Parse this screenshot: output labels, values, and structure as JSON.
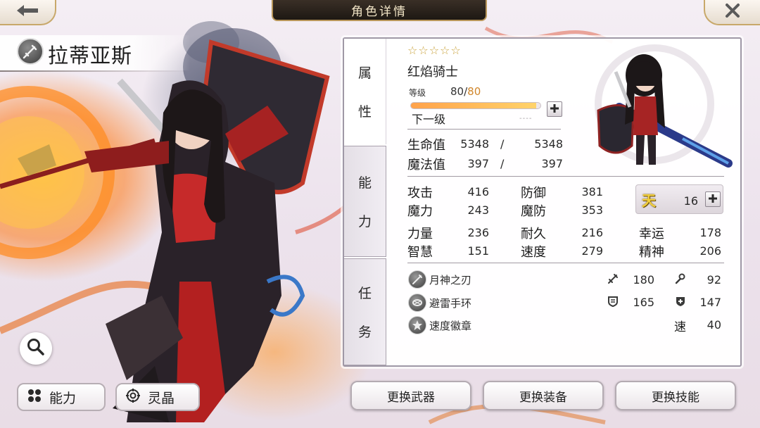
{
  "header": {
    "title": "角色详情",
    "back_icon": "back-arrow-icon",
    "close_icon": "close-x-icon"
  },
  "character": {
    "name": "拉蒂亚斯",
    "class_icon": "sword-icon",
    "stars": "☆☆☆☆☆",
    "class_name": "红焰骑士",
    "level_label": "等级",
    "level": "80",
    "level_sep": "/",
    "level_max": "80",
    "exp_progress": 0.97,
    "next_level_label": "下一级",
    "exp_placeholder": "----"
  },
  "tabs": {
    "attribute": [
      "属",
      "性"
    ],
    "ability": [
      "能",
      "力"
    ],
    "task": [
      "任",
      "务"
    ]
  },
  "vitals": {
    "hp_label": "生命值",
    "hp_current": "5348",
    "hp_max": "5348",
    "mp_label": "魔法值",
    "mp_current": "397",
    "mp_max": "397",
    "sep": "/"
  },
  "stats": {
    "atk_label": "攻击",
    "atk": "416",
    "def_label": "防御",
    "def": "381",
    "mag_label": "魔力",
    "mag": "243",
    "mdef_label": "魔防",
    "mdef": "353",
    "str_label": "力量",
    "str": "236",
    "end_label": "耐久",
    "end": "216",
    "luck_label": "幸运",
    "luck": "178",
    "int_label": "智慧",
    "int": "151",
    "spd_label": "速度",
    "spd": "279",
    "spi_label": "精神",
    "spi": "206"
  },
  "talent": {
    "icon_text": "天",
    "value": "16"
  },
  "equipment": [
    {
      "name": "月神之刃",
      "icon": "blade-icon"
    },
    {
      "name": "避雷手环",
      "icon": "bracelet-icon"
    },
    {
      "name": "速度徽章",
      "icon": "badge-star-icon"
    }
  ],
  "equip_bonus": {
    "atk": "180",
    "mag": "92",
    "def": "165",
    "mdef": "147",
    "spd_label": "速",
    "spd": "40"
  },
  "bottom": {
    "ability_label": "能力",
    "crystal_label": "灵晶",
    "change_weapon": "更换武器",
    "change_equipment": "更换装备",
    "change_skill": "更换技能"
  },
  "colors": {
    "accent_gold": "#c8a86a",
    "level_max": "#d0862a",
    "exp_fill": "#ffa24a"
  }
}
